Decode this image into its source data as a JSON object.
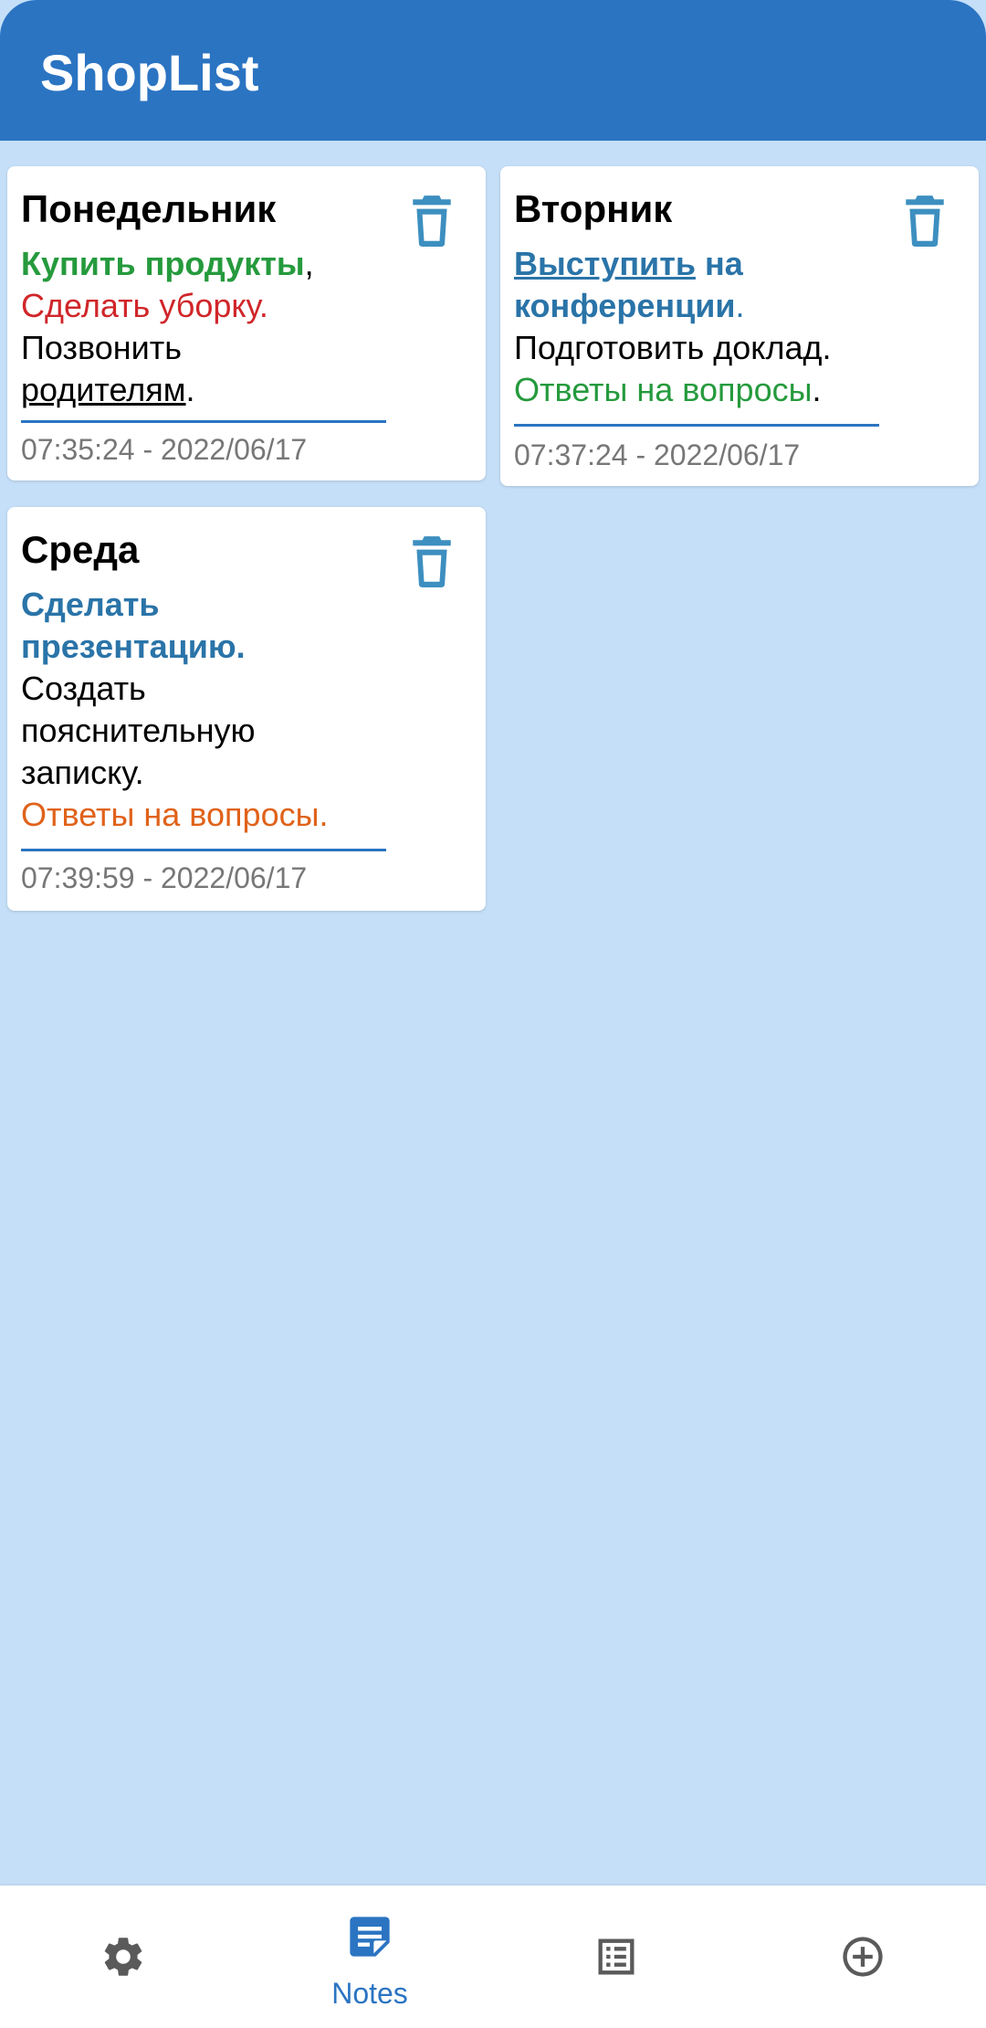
{
  "app": {
    "title": "ShopList"
  },
  "notes": [
    {
      "title": "Понедельник",
      "body": [
        [
          {
            "text": "Купить продукты",
            "style": "b c-green"
          },
          {
            "text": ",",
            "style": "c-black"
          }
        ],
        [
          {
            "text": "Сделать уборку.",
            "style": "c-red"
          }
        ],
        [
          {
            "text": "Позвонить",
            "style": "c-black"
          }
        ],
        [
          {
            "text": "родителям",
            "style": "u c-black"
          },
          {
            "text": ".",
            "style": "c-black"
          }
        ]
      ],
      "time": "07:35:24 - 2022/06/17"
    },
    {
      "title": "Вторник",
      "body": [
        [
          {
            "text": "Выступить",
            "style": "b u c-blue"
          },
          {
            "text": " на",
            "style": "b c-blue"
          }
        ],
        [
          {
            "text": "конференции",
            "style": "b c-blue"
          },
          {
            "text": ".",
            "style": "c-blue"
          }
        ],
        [
          {
            "text": "Подготовить доклад.",
            "style": "c-black"
          }
        ],
        [
          {
            "text": "Ответы на вопросы",
            "style": "c-green"
          },
          {
            "text": ".",
            "style": "c-black"
          }
        ]
      ],
      "time": "07:37:24 - 2022/06/17"
    },
    {
      "title": "Среда",
      "body": [
        [
          {
            "text": "Сделать",
            "style": "b c-blue"
          }
        ],
        [
          {
            "text": "презентацию.",
            "style": "b c-blue"
          }
        ],
        [
          {
            "text": "Создать",
            "style": "c-black"
          }
        ],
        [
          {
            "text": "пояснительную",
            "style": "c-black"
          }
        ],
        [
          {
            "text": "записку.",
            "style": "c-black"
          }
        ],
        [
          {
            "text": "Ответы на вопросы.",
            "style": "c-orange"
          }
        ]
      ],
      "time": "07:39:59 - 2022/06/17"
    }
  ],
  "bottom_nav": {
    "items": [
      {
        "icon": "gear-icon",
        "label": ""
      },
      {
        "icon": "notes-icon",
        "label": "Notes",
        "active": true
      },
      {
        "icon": "list-icon",
        "label": ""
      },
      {
        "icon": "add-circle-icon",
        "label": ""
      }
    ]
  },
  "colors": {
    "primary": "#2b74c2",
    "background": "#c5dff8",
    "delete_icon": "#3d8fc0",
    "nav_inactive": "#5a5a5a"
  }
}
